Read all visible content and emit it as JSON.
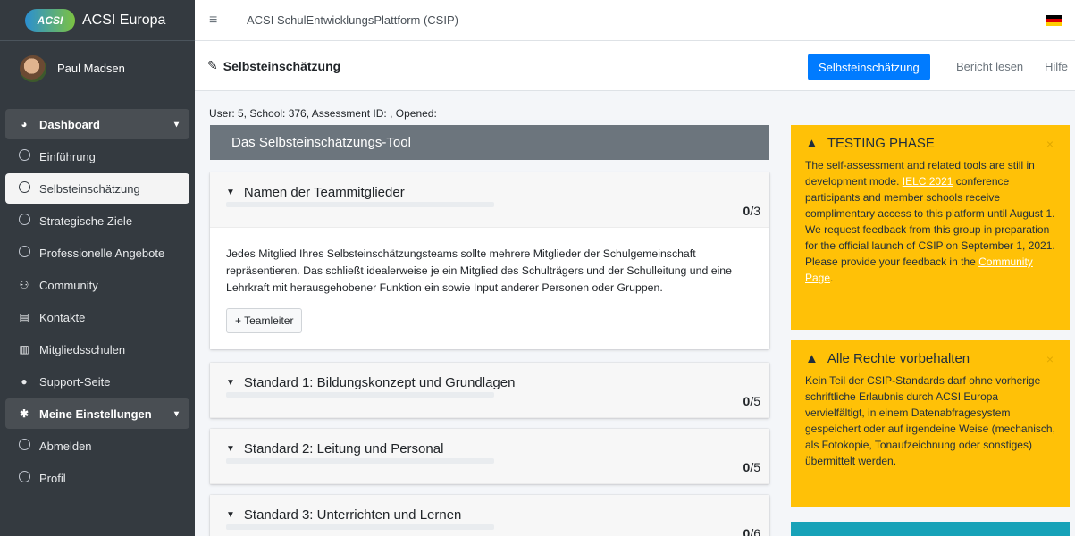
{
  "brand": {
    "logo": "ACSI",
    "name": "ACSI Europa"
  },
  "user": {
    "name": "Paul Madsen"
  },
  "sidebar": {
    "items": [
      {
        "label": "Dashboard",
        "icon": "dashboard-icon"
      },
      {
        "label": "Einführung",
        "icon": "circle-icon"
      },
      {
        "label": "Selbsteinschätzung",
        "icon": "circle-icon"
      },
      {
        "label": "Strategische Ziele",
        "icon": "circle-icon"
      },
      {
        "label": "Professionelle Angebote",
        "icon": "circle-icon"
      },
      {
        "label": "Community",
        "icon": "community-icon"
      },
      {
        "label": "Kontakte",
        "icon": "contact-card-icon"
      },
      {
        "label": "Mitgliedsschulen",
        "icon": "school-icon"
      },
      {
        "label": "Support-Seite",
        "icon": "info-icon"
      },
      {
        "label": "Meine Einstellungen",
        "icon": "gear-icon"
      },
      {
        "label": "Abmelden",
        "icon": "circle-icon"
      },
      {
        "label": "Profil",
        "icon": "circle-icon"
      }
    ]
  },
  "topbar": {
    "title": "ACSI SchulEntwicklungsPlattform (CSIP)"
  },
  "subbar": {
    "title": "Selbsteinschätzung",
    "primary_button": "Selbsteinschätzung",
    "report_link": "Bericht lesen",
    "help_link": "Hilfe"
  },
  "main": {
    "meta": "User: 5, School: 376, Assessment ID: , Opened:",
    "tool_title": "Das Selbsteinschätzungs-Tool",
    "sections": [
      {
        "title": "Namen der Teammitglieder",
        "score": "0",
        "total": "/3",
        "body": "Jedes Mitglied Ihres Selbsteinschätzungsteams sollte mehrere Mitglieder der Schulgemeinschaft repräsentieren. Das schließt idealerweise je ein Mitglied des Schulträgers und der Schulleitung und eine Lehrkraft mit herausgehobener Funktion ein sowie Input anderer Personen oder Gruppen.",
        "button": "+ Teamleiter"
      },
      {
        "title": "Standard 1: Bildungskonzept und Grundlagen",
        "score": "0",
        "total": "/5"
      },
      {
        "title": "Standard 2: Leitung und Personal",
        "score": "0",
        "total": "/5"
      },
      {
        "title": "Standard 3: Unterrichten und Lernen",
        "score": "0",
        "total": "/6"
      }
    ]
  },
  "alerts": {
    "testing": {
      "title": "TESTING PHASE",
      "text1": "The self-assessment and related tools are still in development mode. ",
      "link1": "IELC 2021",
      "text2": " conference participants and member schools receive complimentary access to this platform until August 1. We request feedback from this group in preparation for the official launch of CSIP on September 1, 2021. Please provide your feedback in the ",
      "link2": "Community Page",
      "text3": "."
    },
    "rights": {
      "title": "Alle Rechte vorbehalten",
      "text": "Kein Teil der CSIP-Standards darf ohne vorherige schriftliche Erlaubnis durch ACSI Europa vervielfältigt, in einem Datenabfragesystem gespeichert oder auf irgendeine Weise (mechanisch, als Fotokopie, Tonaufzeichnung oder sonstiges) übermittelt werden."
    },
    "close_symbol": "×"
  },
  "colors": {
    "sidebar": "#343a40",
    "primary": "#007bff",
    "warning": "#ffc107",
    "info": "#17a2b8"
  }
}
